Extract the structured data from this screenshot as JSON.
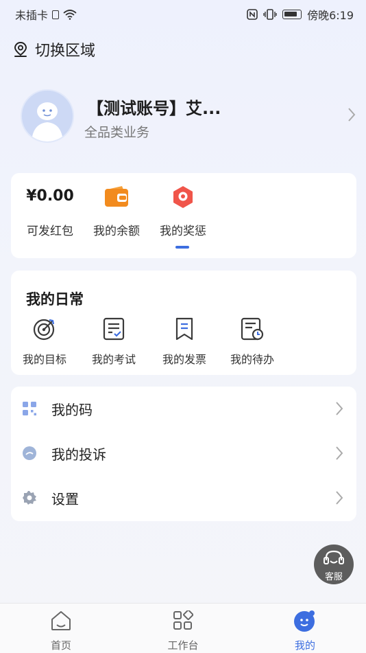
{
  "status_bar": {
    "carrier": "未插卡",
    "time": "傍晚6:19"
  },
  "region": {
    "label": "切换区域"
  },
  "profile": {
    "name": "【测试账号】艾...",
    "role": "全品类业务"
  },
  "wallet": {
    "items": [
      {
        "value": "¥0.00",
        "label": "可发红包"
      },
      {
        "icon": "wallet-icon",
        "label": "我的余额"
      },
      {
        "icon": "award-icon",
        "label": "我的奖惩"
      }
    ],
    "accent": "#3d6ee0"
  },
  "daily": {
    "title": "我的日常",
    "items": [
      {
        "icon": "target-icon",
        "label": "我的目标"
      },
      {
        "icon": "exam-icon",
        "label": "我的考试"
      },
      {
        "icon": "invoice-icon",
        "label": "我的发票"
      },
      {
        "icon": "todo-icon",
        "label": "我的待办"
      }
    ]
  },
  "menu": {
    "items": [
      {
        "icon": "qrcode-icon",
        "label": "我的码"
      },
      {
        "icon": "complaint-icon",
        "label": "我的投诉"
      },
      {
        "icon": "gear-icon",
        "label": "设置"
      }
    ]
  },
  "service": {
    "label": "客服"
  },
  "tabbar": {
    "items": [
      {
        "icon": "home-icon",
        "label": "首页"
      },
      {
        "icon": "workbench-icon",
        "label": "工作台"
      },
      {
        "icon": "mine-icon",
        "label": "我的"
      }
    ],
    "active_color": "#3d6ee0"
  }
}
